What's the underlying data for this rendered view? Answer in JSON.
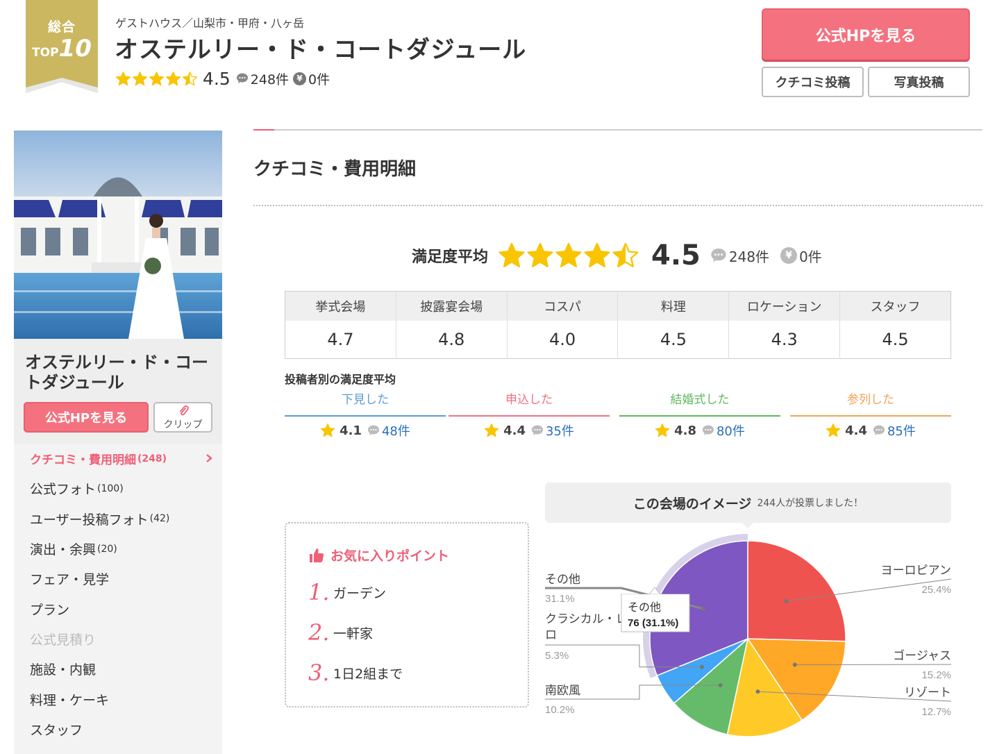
{
  "header": {
    "ribbon_line1": "総合",
    "ribbon_top": "TOP",
    "ribbon_rank": "10",
    "category": "ゲストハウス／山梨市・甲府・八ヶ岳",
    "title": "オステルリー・ド・コートダジュール",
    "score": "4.5",
    "review_count": "248件",
    "cost_count": "0件",
    "hp_button": "公式HPを見る",
    "review_post_button": "クチコミ投稿",
    "photo_post_button": "写真投稿",
    "rating_fraction": 0.9
  },
  "sidebar": {
    "venue_name": "オステルリー・ド・コートダジュール",
    "hp_button": "公式HPを見る",
    "clip_label": "クリップ",
    "menu": [
      {
        "label": "クチコミ・費用明細",
        "count": "(248)",
        "active": true
      },
      {
        "label": "公式フォト",
        "count": "(100)"
      },
      {
        "label": "ユーザー投稿フォト",
        "count": "(42)"
      },
      {
        "label": "演出・余興",
        "count": "(20)"
      },
      {
        "label": "フェア・見学",
        "count": ""
      },
      {
        "label": "プラン",
        "count": ""
      },
      {
        "label": "公式見積り",
        "count": "",
        "disabled": true
      },
      {
        "label": "施設・内観",
        "count": ""
      },
      {
        "label": "料理・ケーキ",
        "count": ""
      },
      {
        "label": "スタッフ",
        "count": ""
      }
    ]
  },
  "main": {
    "title": "クチコミ・費用明細",
    "satisfaction_label": "満足度平均",
    "satisfaction_score": "4.5",
    "review_count": "248件",
    "cost_count": "0件",
    "categories": [
      {
        "name": "挙式会場",
        "score": "4.7"
      },
      {
        "name": "披露宴会場",
        "score": "4.8"
      },
      {
        "name": "コスパ",
        "score": "4.0"
      },
      {
        "name": "料理",
        "score": "4.5"
      },
      {
        "name": "ロケーション",
        "score": "4.3"
      },
      {
        "name": "スタッフ",
        "score": "4.5"
      }
    ],
    "poster_title": "投稿者別の満足度平均",
    "posters": [
      {
        "label": "下見した",
        "score": "4.1",
        "count": "48件",
        "color": "#5b9bd5"
      },
      {
        "label": "申込した",
        "score": "4.4",
        "count": "35件",
        "color": "#ef6f86"
      },
      {
        "label": "結婚式した",
        "score": "4.8",
        "count": "80件",
        "color": "#5cb85c"
      },
      {
        "label": "参列した",
        "score": "4.4",
        "count": "85件",
        "color": "#f0a35a"
      }
    ],
    "favorites": {
      "title": "お気に入りポイント",
      "items": [
        {
          "num": "1.",
          "label": "ガーデン"
        },
        {
          "num": "2.",
          "label": "一軒家"
        },
        {
          "num": "3.",
          "label": "1日2組まで"
        }
      ]
    },
    "image_vote": {
      "title": "この会場のイメージ",
      "subtitle": "244人が投票しました！"
    }
  },
  "chart_data": {
    "type": "pie",
    "title": "この会場のイメージ",
    "slices": [
      {
        "label": "ヨーロピアン",
        "value": 25.4,
        "color": "#ef5350"
      },
      {
        "label": "ゴージャス",
        "value": 15.2,
        "color": "#ffa726"
      },
      {
        "label": "リゾート",
        "value": 12.7,
        "color": "#ffca28"
      },
      {
        "label": "南欧風",
        "value": 10.2,
        "color": "#66bb6a"
      },
      {
        "label": "クラシカル・レトロ",
        "value": 5.3,
        "color": "#42a5f5"
      },
      {
        "label": "その他",
        "value": 31.1,
        "color": "#7e57c2"
      }
    ],
    "tooltip": {
      "label": "その他",
      "value": "76 (31.1%)"
    }
  }
}
